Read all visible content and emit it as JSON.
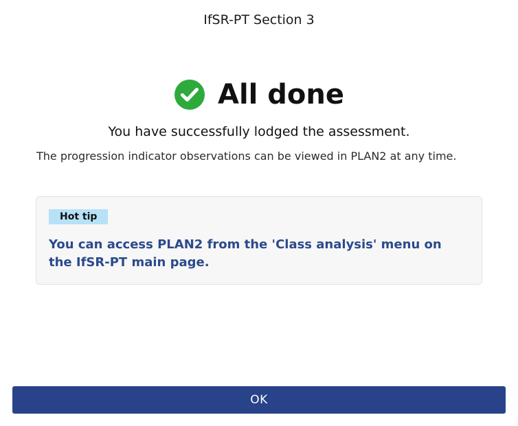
{
  "dialog": {
    "title": "IfSR-PT Section 3",
    "status": {
      "icon": "check-circle-icon",
      "color": "#2eaa3c",
      "heading": "All done"
    },
    "subtitle": "You have successfully lodged the assessment.",
    "body_text": "The progression indicator observations can be viewed in PLAN2 at any time.",
    "tip": {
      "badge": "Hot tip",
      "badge_color": "#b7e1f7",
      "text": "You can access PLAN2 from the 'Class analysis' menu on the IfSR-PT main page.",
      "text_color": "#2b4a8c"
    },
    "ok_button": {
      "label": "OK",
      "color": "#28438a"
    }
  }
}
